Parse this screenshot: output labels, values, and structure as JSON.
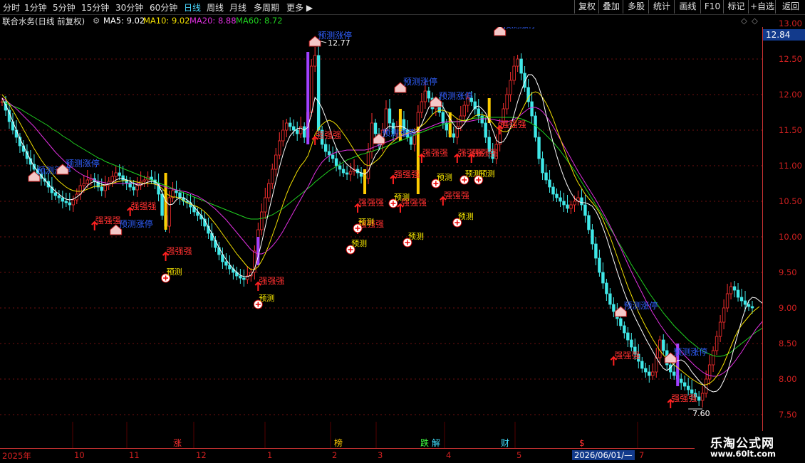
{
  "toolbar": {
    "timeframes": [
      "分时",
      "1分钟",
      "5分钟",
      "15分钟",
      "30分钟",
      "60分钟",
      "日线",
      "周线",
      "月线",
      "多周期",
      "更多"
    ],
    "active": "日线",
    "right_buttons": [
      "复权",
      "叠加",
      "多股",
      "统计",
      "画线",
      "F10",
      "标记",
      "+自选",
      "返回"
    ]
  },
  "info": {
    "title": "联合水务(日线 前复权)",
    "ma5": "MA5: 9.02",
    "ma10": "MA10: 9.02",
    "ma20": "MA20: 8.88",
    "ma60": "MA60: 8.72",
    "ma_colors": {
      "ma5": "#ffffff",
      "ma10": "#f3e000",
      "ma20": "#e030e0",
      "ma60": "#20d020"
    }
  },
  "axis": {
    "labels": [
      "13.00",
      "12.84",
      "12.50",
      "12.00",
      "11.50",
      "11.00",
      "10.50",
      "10.00",
      "9.50",
      "9.00",
      "8.50",
      "8.00",
      "7.50"
    ],
    "current_price": "12.84"
  },
  "annotations": {
    "high_label": "12.77",
    "low_label": "7.60",
    "up_text": "预测涨停",
    "strong_text": "强强强",
    "predict_text": "预测"
  },
  "xaxis": [
    "2025年",
    "10",
    "11",
    "12",
    "1",
    "2",
    "3",
    "4",
    "5",
    "2026/06/01/—",
    "7"
  ],
  "events": [
    {
      "t": "涨",
      "c": "#ff3030"
    },
    {
      "t": "榜",
      "c": "#ffcc00"
    },
    {
      "t": "跌",
      "c": "#40ff40"
    },
    {
      "t": "解",
      "c": "#40e0ff"
    },
    {
      "t": "财",
      "c": "#40e0ff"
    },
    {
      "t": "$",
      "c": "#ff3030"
    }
  ],
  "watermark": {
    "name": "乐淘公式网",
    "url": "www.60lt.com"
  },
  "chart_data": {
    "type": "candlestick",
    "ylim": [
      7.4,
      12.95
    ],
    "close_series": [
      11.9,
      11.78,
      11.62,
      11.5,
      11.4,
      11.28,
      11.2,
      11.1,
      11.02,
      10.95,
      10.88,
      10.82,
      10.78,
      10.7,
      10.62,
      10.58,
      10.55,
      10.5,
      10.48,
      10.45,
      10.52,
      10.6,
      10.72,
      10.75,
      10.8,
      10.82,
      10.78,
      10.7,
      10.65,
      10.72,
      10.78,
      10.85,
      10.9,
      10.86,
      10.8,
      10.76,
      10.7,
      10.66,
      10.72,
      10.78,
      10.8,
      10.84,
      10.8,
      10.75,
      10.6,
      10.3,
      10.15,
      10.55,
      10.65,
      10.62,
      10.55,
      10.5,
      10.48,
      10.42,
      10.35,
      10.3,
      10.25,
      10.15,
      10.05,
      9.95,
      9.85,
      9.75,
      9.65,
      9.6,
      9.55,
      9.5,
      9.45,
      9.42,
      9.4,
      9.45,
      9.5,
      9.8,
      10.1,
      10.35,
      10.55,
      10.75,
      10.95,
      11.15,
      11.35,
      11.5,
      11.6,
      11.55,
      11.5,
      11.45,
      11.55,
      11.4,
      11.75,
      12.4,
      12.55,
      11.5,
      11.3,
      11.2,
      11.15,
      11.1,
      11.0,
      10.95,
      10.9,
      10.88,
      10.92,
      10.95,
      10.9,
      10.85,
      10.82,
      11.2,
      11.6,
      11.45,
      11.3,
      11.5,
      11.8,
      11.6,
      11.45,
      11.55,
      11.65,
      11.5,
      11.4,
      11.3,
      11.45,
      11.75,
      11.9,
      12.05,
      11.95,
      11.8,
      11.85,
      11.75,
      11.6,
      11.5,
      11.45,
      11.4,
      11.55,
      11.7,
      11.85,
      11.95,
      11.9,
      11.8,
      11.7,
      11.6,
      11.4,
      11.2,
      11.1,
      11.3,
      11.6,
      11.8,
      12.0,
      12.2,
      12.4,
      12.5,
      12.3,
      12.1,
      11.9,
      11.7,
      11.4,
      11.1,
      10.9,
      10.8,
      10.7,
      10.6,
      10.55,
      10.5,
      10.45,
      10.4,
      10.45,
      10.5,
      10.55,
      10.45,
      10.3,
      10.1,
      9.9,
      9.7,
      9.5,
      9.35,
      9.2,
      9.05,
      8.95,
      8.85,
      8.75,
      8.65,
      8.55,
      8.45,
      8.35,
      8.25,
      8.15,
      8.1,
      8.05,
      8.1,
      8.3,
      8.55,
      8.4,
      8.2,
      8.1,
      8.05,
      8.0,
      7.95,
      7.9,
      7.85,
      7.8,
      7.75,
      7.7,
      7.8,
      8.0,
      8.2,
      8.4,
      8.6,
      8.8,
      9.0,
      9.2,
      9.3,
      9.25,
      9.15,
      9.1,
      9.05,
      9.02,
      9.0
    ],
    "ma5": [
      11.95,
      11.85,
      11.75,
      11.62,
      11.5,
      11.38,
      11.28,
      11.18,
      11.08,
      10.99,
      10.92,
      10.86,
      10.8,
      10.74,
      10.69,
      10.64,
      10.6,
      10.56,
      10.53,
      10.52,
      10.53,
      10.56,
      10.6,
      10.66,
      10.72,
      10.76,
      10.78,
      10.76,
      10.74,
      10.73,
      10.74,
      10.76,
      10.8,
      10.82,
      10.82,
      10.8,
      10.78,
      10.75,
      10.73,
      10.73,
      10.75,
      10.77,
      10.78,
      10.78,
      10.73,
      10.62,
      10.5,
      10.45,
      10.46,
      10.52,
      10.55,
      10.55,
      10.52,
      10.48,
      10.42,
      10.36,
      10.3,
      10.23,
      10.14,
      10.05,
      9.95,
      9.85,
      9.76,
      9.68,
      9.61,
      9.55,
      9.5,
      9.46,
      9.44,
      9.44,
      9.46,
      9.55,
      9.72,
      9.92,
      10.14,
      10.36,
      10.57,
      10.78,
      10.98,
      11.16,
      11.31,
      11.42,
      11.48,
      11.52,
      11.53,
      11.5,
      11.54,
      11.73,
      11.96,
      11.9,
      11.81,
      11.68,
      11.55,
      11.38,
      11.25,
      11.16,
      11.08,
      11.02,
      10.98,
      10.94,
      10.92,
      10.9,
      10.88,
      10.92,
      11.04,
      11.15,
      11.22,
      11.34,
      11.52,
      11.56,
      11.54,
      11.55,
      11.56,
      11.54,
      11.51,
      11.48,
      11.46,
      11.5,
      11.58,
      11.7,
      11.82,
      11.88,
      11.92,
      11.89,
      11.83,
      11.74,
      11.66,
      11.58,
      11.52,
      11.53,
      11.59,
      11.67,
      11.75,
      11.82,
      11.84,
      11.8,
      11.74,
      11.63,
      11.5,
      11.36,
      11.32,
      11.34,
      11.42,
      11.54,
      11.72,
      11.9,
      12.05,
      12.18,
      12.28,
      12.28,
      12.22,
      12.1,
      11.94,
      11.72,
      11.52,
      11.32,
      11.14,
      10.98,
      10.84,
      10.72,
      10.62,
      10.54,
      10.5,
      10.48,
      10.48,
      10.46,
      10.43,
      10.36,
      10.26,
      10.13,
      9.99,
      9.83,
      9.67,
      9.51,
      9.36,
      9.22,
      9.09,
      8.98,
      8.87,
      8.77,
      8.67,
      8.57,
      8.48,
      8.39,
      8.3,
      8.22,
      8.15,
      8.12,
      8.16,
      8.22,
      8.26,
      8.27,
      8.24,
      8.18,
      8.1,
      8.04,
      7.98,
      7.93,
      7.88,
      7.84,
      7.82,
      7.83,
      7.88,
      7.98,
      8.1,
      8.27,
      8.46,
      8.64,
      8.82,
      8.98,
      9.1,
      9.15,
      9.14,
      9.1,
      9.06,
      9.02
    ],
    "ma10": [
      12.0,
      11.94,
      11.86,
      11.78,
      11.69,
      11.6,
      11.51,
      11.42,
      11.33,
      11.24,
      11.16,
      11.08,
      11.01,
      10.95,
      10.89,
      10.83,
      10.78,
      10.74,
      10.7,
      10.67,
      10.65,
      10.64,
      10.64,
      10.65,
      10.67,
      10.69,
      10.71,
      10.71,
      10.72,
      10.73,
      10.74,
      10.75,
      10.77,
      10.78,
      10.79,
      10.79,
      10.79,
      10.78,
      10.77,
      10.76,
      10.75,
      10.75,
      10.75,
      10.74,
      10.72,
      10.68,
      10.62,
      10.58,
      10.56,
      10.56,
      10.54,
      10.51,
      10.48,
      10.46,
      10.44,
      10.42,
      10.39,
      10.35,
      10.3,
      10.24,
      10.18,
      10.11,
      10.04,
      9.97,
      9.9,
      9.83,
      9.76,
      9.7,
      9.64,
      9.58,
      9.54,
      9.54,
      9.58,
      9.66,
      9.76,
      9.88,
      10.02,
      10.16,
      10.31,
      10.46,
      10.6,
      10.72,
      10.82,
      10.92,
      11.0,
      11.06,
      11.14,
      11.28,
      11.44,
      11.52,
      11.58,
      11.62,
      11.64,
      11.62,
      11.58,
      11.52,
      11.45,
      11.38,
      11.3,
      11.22,
      11.14,
      11.08,
      11.02,
      11.0,
      11.02,
      11.06,
      11.1,
      11.16,
      11.24,
      11.3,
      11.34,
      11.38,
      11.42,
      11.44,
      11.46,
      11.48,
      11.5,
      11.52,
      11.56,
      11.6,
      11.66,
      11.72,
      11.76,
      11.78,
      11.78,
      11.76,
      11.74,
      11.7,
      11.66,
      11.64,
      11.63,
      11.64,
      11.66,
      11.7,
      11.72,
      11.72,
      11.7,
      11.66,
      11.6,
      11.54,
      11.5,
      11.48,
      11.48,
      11.52,
      11.58,
      11.66,
      11.76,
      11.86,
      11.96,
      12.02,
      12.04,
      12.02,
      11.96,
      11.88,
      11.78,
      11.66,
      11.52,
      11.38,
      11.24,
      11.1,
      10.98,
      10.86,
      10.76,
      10.68,
      10.6,
      10.54,
      10.48,
      10.42,
      10.34,
      10.24,
      10.12,
      10.0,
      9.86,
      9.72,
      9.58,
      9.44,
      9.3,
      9.18,
      9.06,
      8.94,
      8.84,
      8.74,
      8.65,
      8.56,
      8.48,
      8.4,
      8.34,
      8.28,
      8.24,
      8.2,
      8.16,
      8.12,
      8.08,
      8.04,
      8.0,
      7.97,
      7.94,
      7.92,
      7.92,
      7.94,
      7.98,
      8.04,
      8.12,
      8.22,
      8.34,
      8.46,
      8.58,
      8.68,
      8.76,
      8.82,
      8.88,
      8.94,
      8.98,
      9.02
    ],
    "ma20": [
      11.95,
      11.92,
      11.88,
      11.84,
      11.8,
      11.75,
      11.7,
      11.65,
      11.6,
      11.55,
      11.49,
      11.43,
      11.37,
      11.31,
      11.25,
      11.19,
      11.14,
      11.09,
      11.04,
      11.0,
      10.96,
      10.92,
      10.89,
      10.86,
      10.84,
      10.82,
      10.8,
      10.78,
      10.77,
      10.76,
      10.75,
      10.75,
      10.75,
      10.75,
      10.75,
      10.75,
      10.75,
      10.75,
      10.75,
      10.75,
      10.75,
      10.75,
      10.75,
      10.74,
      10.73,
      10.72,
      10.7,
      10.68,
      10.67,
      10.66,
      10.65,
      10.64,
      10.63,
      10.61,
      10.59,
      10.57,
      10.54,
      10.51,
      10.47,
      10.43,
      10.39,
      10.34,
      10.29,
      10.24,
      10.18,
      10.12,
      10.06,
      10.0,
      9.94,
      9.88,
      9.82,
      9.78,
      9.76,
      9.76,
      9.78,
      9.82,
      9.87,
      9.93,
      10.0,
      10.08,
      10.17,
      10.26,
      10.35,
      10.44,
      10.53,
      10.62,
      10.7,
      10.8,
      10.9,
      10.98,
      11.05,
      11.1,
      11.14,
      11.17,
      11.19,
      11.2,
      11.21,
      11.22,
      11.22,
      11.22,
      11.22,
      11.22,
      11.22,
      11.23,
      11.25,
      11.27,
      11.29,
      11.31,
      11.33,
      11.35,
      11.37,
      11.39,
      11.41,
      11.43,
      11.45,
      11.46,
      11.47,
      11.48,
      11.5,
      11.52,
      11.54,
      11.56,
      11.58,
      11.6,
      11.61,
      11.62,
      11.62,
      11.62,
      11.62,
      11.62,
      11.62,
      11.62,
      11.63,
      11.64,
      11.65,
      11.66,
      11.66,
      11.66,
      11.65,
      11.64,
      11.63,
      11.62,
      11.62,
      11.63,
      11.65,
      11.68,
      11.72,
      11.76,
      11.8,
      11.82,
      11.82,
      11.8,
      11.76,
      11.7,
      11.63,
      11.55,
      11.46,
      11.37,
      11.28,
      11.19,
      11.1,
      11.01,
      10.92,
      10.84,
      10.76,
      10.68,
      10.6,
      10.52,
      10.43,
      10.34,
      10.25,
      10.15,
      10.05,
      9.94,
      9.84,
      9.73,
      9.62,
      9.51,
      9.41,
      9.31,
      9.21,
      9.11,
      9.02,
      8.93,
      8.85,
      8.77,
      8.7,
      8.63,
      8.57,
      8.51,
      8.45,
      8.39,
      8.33,
      8.28,
      8.23,
      8.18,
      8.14,
      8.1,
      8.07,
      8.05,
      8.04,
      8.04,
      8.06,
      8.09,
      8.13,
      8.18,
      8.24,
      8.31,
      8.38,
      8.46,
      8.54,
      8.62,
      8.7,
      8.76,
      8.82,
      8.88
    ],
    "ma60": [
      11.9,
      11.88,
      11.86,
      11.84,
      11.82,
      11.8,
      11.77,
      11.74,
      11.71,
      11.68,
      11.65,
      11.62,
      11.59,
      11.56,
      11.52,
      11.49,
      11.46,
      11.42,
      11.39,
      11.36,
      11.32,
      11.29,
      11.26,
      11.23,
      11.2,
      11.17,
      11.14,
      11.11,
      11.09,
      11.06,
      11.04,
      11.02,
      11.0,
      10.98,
      10.96,
      10.94,
      10.92,
      10.9,
      10.88,
      10.86,
      10.84,
      10.82,
      10.8,
      10.78,
      10.76,
      10.74,
      10.72,
      10.7,
      10.68,
      10.66,
      10.64,
      10.62,
      10.6,
      10.58,
      10.56,
      10.54,
      10.52,
      10.5,
      10.48,
      10.46,
      10.44,
      10.42,
      10.4,
      10.38,
      10.36,
      10.34,
      10.32,
      10.3,
      10.28,
      10.26,
      10.25,
      10.25,
      10.25,
      10.26,
      10.27,
      10.29,
      10.31,
      10.34,
      10.37,
      10.4,
      10.44,
      10.48,
      10.52,
      10.56,
      10.6,
      10.64,
      10.68,
      10.72,
      10.77,
      10.81,
      10.85,
      10.89,
      10.93,
      10.96,
      10.99,
      11.02,
      11.05,
      11.08,
      11.1,
      11.12,
      11.14,
      11.16,
      11.17,
      11.19,
      11.2,
      11.22,
      11.23,
      11.25,
      11.27,
      11.29,
      11.31,
      11.33,
      11.35,
      11.37,
      11.39,
      11.41,
      11.43,
      11.45,
      11.47,
      11.49,
      11.51,
      11.53,
      11.55,
      11.56,
      11.58,
      11.59,
      11.6,
      11.61,
      11.62,
      11.63,
      11.64,
      11.65,
      11.66,
      11.67,
      11.67,
      11.68,
      11.68,
      11.68,
      11.68,
      11.68,
      11.68,
      11.68,
      11.68,
      11.68,
      11.68,
      11.67,
      11.66,
      11.64,
      11.62,
      11.59,
      11.56,
      11.52,
      11.48,
      11.43,
      11.38,
      11.33,
      11.27,
      11.21,
      11.14,
      11.07,
      11.0,
      10.93,
      10.85,
      10.77,
      10.69,
      10.61,
      10.53,
      10.45,
      10.37,
      10.29,
      10.21,
      10.12,
      10.04,
      9.95,
      9.87,
      9.78,
      9.7,
      9.61,
      9.53,
      9.45,
      9.37,
      9.29,
      9.21,
      9.14,
      9.07,
      9.0,
      8.93,
      8.87,
      8.81,
      8.75,
      8.7,
      8.65,
      8.6,
      8.55,
      8.51,
      8.47,
      8.43,
      8.4,
      8.37,
      8.35,
      8.33,
      8.32,
      8.32,
      8.33,
      8.35,
      8.38,
      8.42,
      8.46,
      8.5,
      8.54,
      8.58,
      8.62,
      8.66,
      8.69,
      8.72
    ],
    "high": {
      "value": 12.77,
      "index": 88
    },
    "low": {
      "value": 7.6,
      "index": 197
    }
  }
}
